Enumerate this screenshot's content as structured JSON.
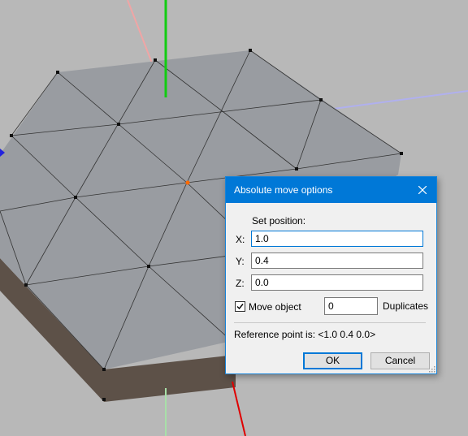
{
  "viewport": {
    "description_icon": "3d-viewport",
    "colors": {
      "background": "#b8b8b8",
      "top_face": "#999ca1",
      "side_face": "#5d5148",
      "x_axis": "#e00000",
      "y_axis": "#11cc11",
      "z_axis": "#2222dd"
    }
  },
  "dialog": {
    "title": "Absolute move options",
    "close_icon": "close-icon",
    "set_position_label": "Set position:",
    "x_label": "X:",
    "x_value": "1.0",
    "y_label": "Y:",
    "y_value": "0.4",
    "z_label": "Z:",
    "z_value": "0.0",
    "move_object_label": "Move object",
    "move_object_checked": true,
    "duplicates_value": "0",
    "duplicates_label": "Duplicates",
    "reference_point_text": "Reference point is: <1.0  0.4  0.0>",
    "ok_label": "OK",
    "cancel_label": "Cancel",
    "accent": "#0078d7"
  }
}
